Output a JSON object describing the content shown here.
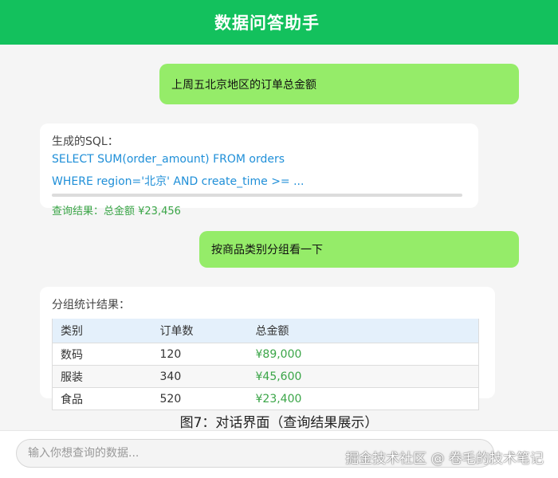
{
  "colors": {
    "brand": "#13c15d",
    "user_bubble": "#95ec69",
    "sql": "#1f8fd8",
    "result": "#3aa547",
    "table_header": "#e4f0fb"
  },
  "header": {
    "title": "数据问答助手"
  },
  "messages": {
    "user1": "上周五北京地区的订单总金额",
    "sql_label": "生成的SQL：",
    "sql_line1": "SELECT SUM(order_amount) FROM orders",
    "sql_line2": "WHERE region='北京' AND create_time >= ...",
    "result": "查询结果：总金额 ¥23,456",
    "user2": "按商品类别分组看一下",
    "group_label": "分组统计结果："
  },
  "table": {
    "headers": [
      "类别",
      "订单数",
      "总金额"
    ],
    "rows": [
      [
        "数码",
        "120",
        "¥89,000"
      ],
      [
        "服装",
        "340",
        "¥45,600"
      ],
      [
        "食品",
        "520",
        "¥23,400"
      ]
    ]
  },
  "caption": "图7：对话界面（查询结果展示）",
  "input": {
    "placeholder": "输入你想查询的数据..."
  },
  "watermark": "掘金技术社区 @ 卷毛的技术笔记"
}
